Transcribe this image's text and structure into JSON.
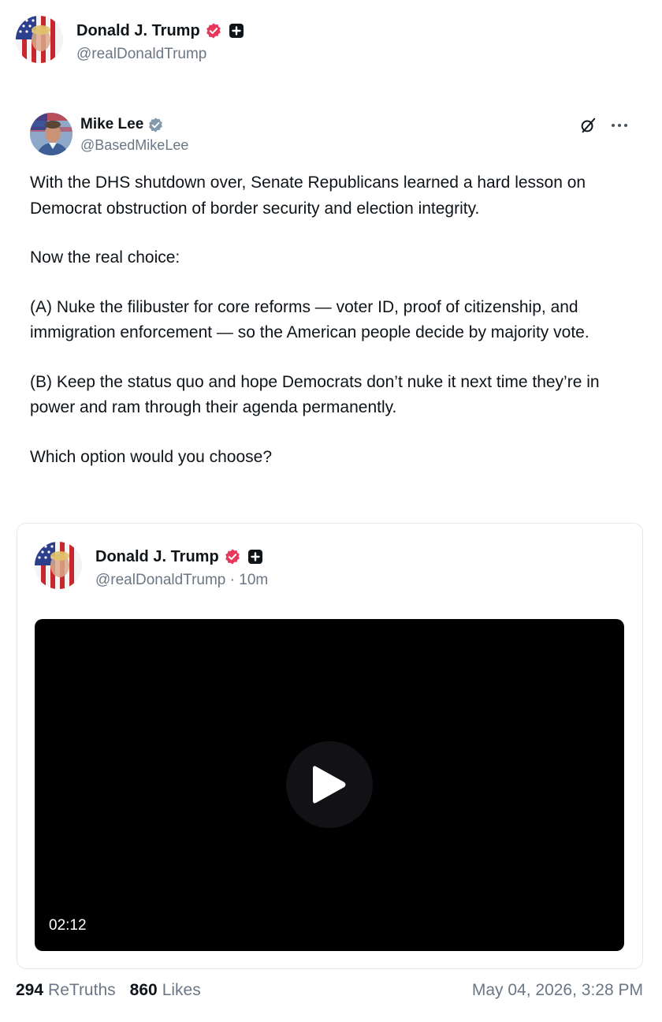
{
  "author": {
    "name": "Donald J. Trump",
    "handle": "@realDonaldTrump"
  },
  "embedded_post": {
    "name": "Mike Lee",
    "handle": "@BasedMikeLee",
    "paragraphs": [
      "With the DHS shutdown over, Senate Republicans learned a hard lesson on Democrat obstruction of border security and election integrity.",
      "Now the real choice:",
      "(A) Nuke the filibuster for core reforms — voter ID, proof of citizenship, and immigration enforcement — so the American people decide by majority vote.",
      "(B) Keep the status quo and hope Democrats don’t nuke it next time they’re in power and ram through their agenda permanently.",
      "Which option would you choose?"
    ]
  },
  "quoted_truth": {
    "name": "Donald J. Trump",
    "handle": "@realDonaldTrump",
    "age": "10m",
    "video": {
      "duration": "02:12"
    }
  },
  "footer": {
    "retruths_count": "294",
    "retruths_label": "ReTruths",
    "likes_count": "860",
    "likes_label": "Likes",
    "timestamp": "May 04, 2026, 3:28 PM"
  },
  "colors": {
    "verified_truth": "#e8375a",
    "verified_x": "#829aab",
    "text_primary": "#0f1419",
    "text_secondary": "#6b7785"
  },
  "icons": [
    "verified-badge-icon",
    "plus-badge-icon",
    "grok-icon",
    "more-icon",
    "play-icon"
  ]
}
